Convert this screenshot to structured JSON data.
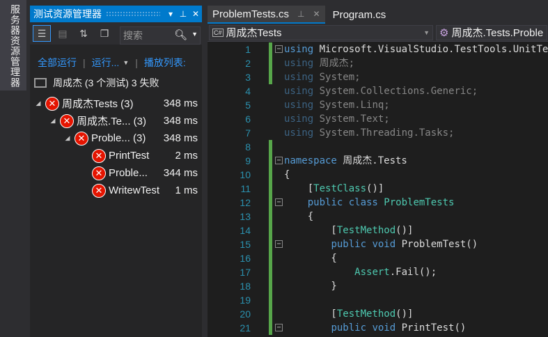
{
  "side_tab": {
    "label": "服务器资源管理器"
  },
  "explorer": {
    "title": "测试资源管理器",
    "controls": [
      "▾",
      "⊥",
      "✕"
    ],
    "search_placeholder": "搜索",
    "actions": {
      "run_all": "全部运行",
      "run": "运行...",
      "playlist": "播放列表:"
    },
    "summary": "周成杰 (3 个测试) 3 失败",
    "tree": [
      {
        "name": "周成杰Tests (3)",
        "time": "348 ms"
      },
      {
        "name": "周成杰.Te... (3)",
        "time": "348 ms"
      },
      {
        "name": "Proble... (3)",
        "time": "348 ms"
      },
      {
        "name": "PrintTest",
        "time": "2 ms"
      },
      {
        "name": "Proble...",
        "time": "344 ms"
      },
      {
        "name": "WritewTest",
        "time": "1 ms"
      }
    ]
  },
  "tabs": [
    {
      "label": "ProblemTests.cs",
      "pin": "⊥",
      "close": "✕"
    },
    {
      "label": "Program.cs"
    }
  ],
  "nav": {
    "project": "周成杰Tests",
    "project_badge": "C#",
    "class": "周成杰.Tests.Proble"
  },
  "code_lines": [
    {
      "n": "1",
      "kw": "using",
      "rest": " Microsoft.VisualStudio.TestTools.UnitTesti"
    },
    {
      "n": "2",
      "kw": "using",
      "rest": " 周成杰;"
    },
    {
      "n": "3",
      "kw": "using",
      "rest": " System;"
    },
    {
      "n": "4",
      "kw": "using",
      "rest": " System.Collections.Generic;"
    },
    {
      "n": "5",
      "kw": "using",
      "rest": " System.Linq;"
    },
    {
      "n": "6",
      "kw": "using",
      "rest": " System.Text;"
    },
    {
      "n": "7",
      "kw": "using",
      "rest": " System.Threading.Tasks;"
    },
    {
      "n": "8",
      "text": ""
    },
    {
      "n": "9",
      "kw": "namespace",
      "rest": " 周成杰.Tests"
    },
    {
      "n": "10",
      "text": "{"
    },
    {
      "n": "11",
      "pre": "    [",
      "cls": "TestClass",
      "post": "()]"
    },
    {
      "n": "12",
      "pre": "    ",
      "kw": "public class",
      "cls": " ProblemTests"
    },
    {
      "n": "13",
      "text": "    {"
    },
    {
      "n": "14",
      "pre": "        [",
      "cls": "TestMethod",
      "post": "()]"
    },
    {
      "n": "15",
      "pre": "        ",
      "kw": "public void",
      "rest": " ProblemTest()"
    },
    {
      "n": "16",
      "text": "        {"
    },
    {
      "n": "17",
      "pre": "            ",
      "cls": "Assert",
      "post": ".Fail();"
    },
    {
      "n": "18",
      "text": "        }"
    },
    {
      "n": "19",
      "text": ""
    },
    {
      "n": "20",
      "pre": "        [",
      "cls": "TestMethod",
      "post": "()]"
    },
    {
      "n": "21",
      "pre": "        ",
      "kw": "public void",
      "rest": " PrintTest()"
    }
  ]
}
